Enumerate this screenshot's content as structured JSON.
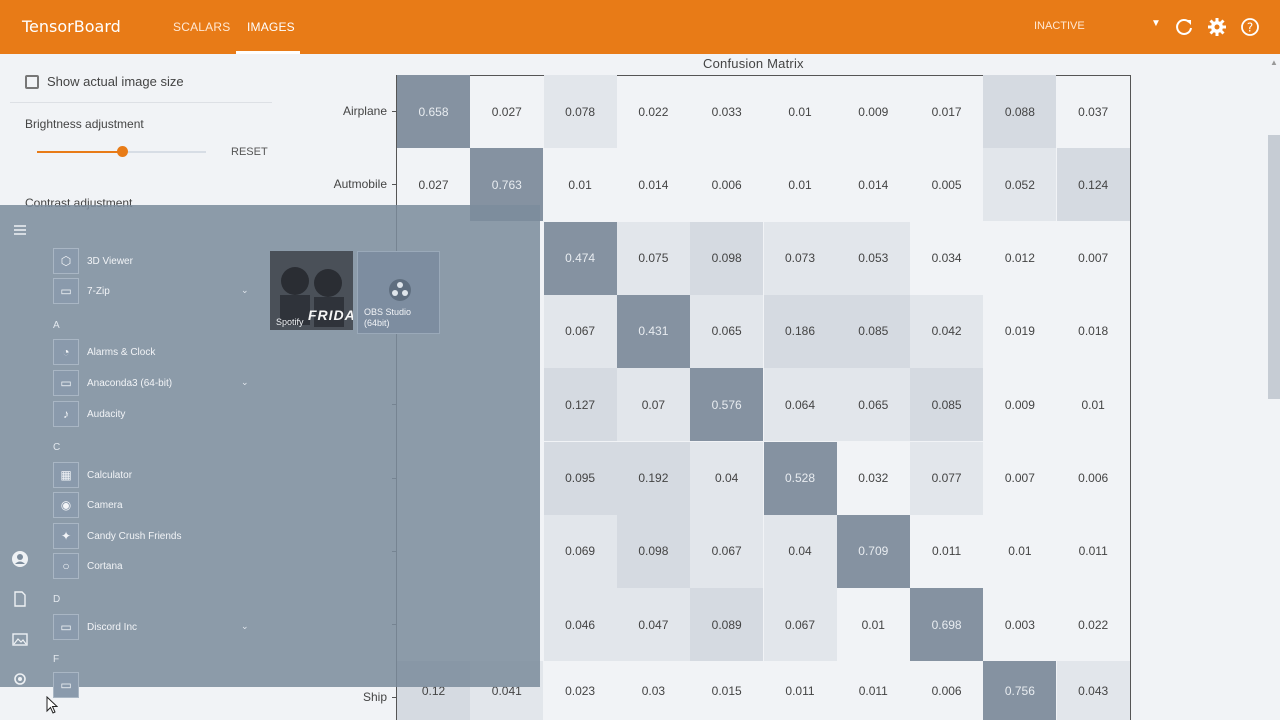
{
  "header": {
    "brand": "TensorBoard",
    "tabs": [
      {
        "label": "SCALARS",
        "active": false
      },
      {
        "label": "IMAGES",
        "active": true
      }
    ],
    "run_status": "INACTIVE",
    "icons": [
      "dropdown-caret-icon",
      "refresh-icon",
      "gear-icon",
      "help-icon"
    ],
    "colors": {
      "bar": "#e87b17",
      "text": "#ffffff"
    }
  },
  "settings": {
    "show_actual_size_label": "Show actual image size",
    "show_actual_size_checked": false,
    "brightness_label": "Brightness adjustment",
    "brightness_value": 0.5,
    "reset_label": "RESET",
    "contrast_label": "Contrast adjustment"
  },
  "matrix": {
    "title": "Confusion Matrix",
    "row_labels": [
      "Airplane",
      "Autmobile",
      "",
      "",
      "",
      "",
      "",
      "",
      "Ship"
    ],
    "rows": [
      [
        "0.658",
        "0.027",
        "0.078",
        "0.022",
        "0.033",
        "0.01",
        "0.009",
        "0.017",
        "0.088",
        "0.037"
      ],
      [
        "0.027",
        "0.763",
        "0.01",
        "0.014",
        "0.006",
        "0.01",
        "0.014",
        "0.005",
        "0.052",
        "0.124"
      ],
      [
        "",
        "",
        "0.474",
        "0.075",
        "0.098",
        "0.073",
        "0.053",
        "0.034",
        "0.012",
        "0.007"
      ],
      [
        "",
        "",
        "0.067",
        "0.431",
        "0.065",
        "0.186",
        "0.085",
        "0.042",
        "0.019",
        "0.018"
      ],
      [
        "",
        "",
        "0.127",
        "0.07",
        "0.576",
        "0.064",
        "0.065",
        "0.085",
        "0.009",
        "0.01"
      ],
      [
        "",
        "",
        "0.095",
        "0.192",
        "0.04",
        "0.528",
        "0.032",
        "0.077",
        "0.007",
        "0.006"
      ],
      [
        "",
        "",
        "0.069",
        "0.098",
        "0.067",
        "0.04",
        "0.709",
        "0.011",
        "0.01",
        "0.011"
      ],
      [
        "",
        "",
        "0.046",
        "0.047",
        "0.089",
        "0.067",
        "0.01",
        "0.698",
        "0.003",
        "0.022"
      ],
      [
        "0.12",
        "0.041",
        "0.023",
        "0.03",
        "0.015",
        "0.011",
        "0.011",
        "0.006",
        "0.756",
        "0.043"
      ]
    ],
    "colors": {
      "diagonal": "#8592a1",
      "high": "#d5dae1",
      "mid": "#e2e6eb",
      "low": "#eef0f3"
    }
  },
  "start_menu": {
    "apps": [
      {
        "letter": "",
        "name": "3D Viewer",
        "icon": "cube-icon",
        "expand": false
      },
      {
        "letter": "",
        "name": "7-Zip",
        "icon": "folder-icon",
        "expand": true
      },
      {
        "letter": "A",
        "name": "Alarms & Clock",
        "icon": "clock-icon",
        "expand": false
      },
      {
        "letter": "",
        "name": "Anaconda3 (64-bit)",
        "icon": "folder-icon",
        "expand": true
      },
      {
        "letter": "",
        "name": "Audacity",
        "icon": "audio-icon",
        "expand": false
      },
      {
        "letter": "C",
        "name": "Calculator",
        "icon": "calculator-icon",
        "expand": false
      },
      {
        "letter": "",
        "name": "Camera",
        "icon": "camera-icon",
        "expand": false
      },
      {
        "letter": "",
        "name": "Candy Crush Friends",
        "icon": "game-icon",
        "expand": false
      },
      {
        "letter": "",
        "name": "Cortana",
        "icon": "cortana-icon",
        "expand": false
      },
      {
        "letter": "D",
        "name": "Discord Inc",
        "icon": "folder-icon",
        "expand": true
      },
      {
        "letter": "F",
        "name": "",
        "icon": "folder-icon",
        "expand": false
      }
    ],
    "tiles": [
      {
        "name": "Spotify",
        "art_text": "FRIDAY",
        "icon": "spotify-icon"
      },
      {
        "name": "OBS Studio (64bit)",
        "icon": "obs-icon"
      }
    ],
    "rail_icons": [
      "hamburger-icon",
      "user-icon",
      "document-icon",
      "pictures-icon",
      "settings-icon"
    ]
  }
}
